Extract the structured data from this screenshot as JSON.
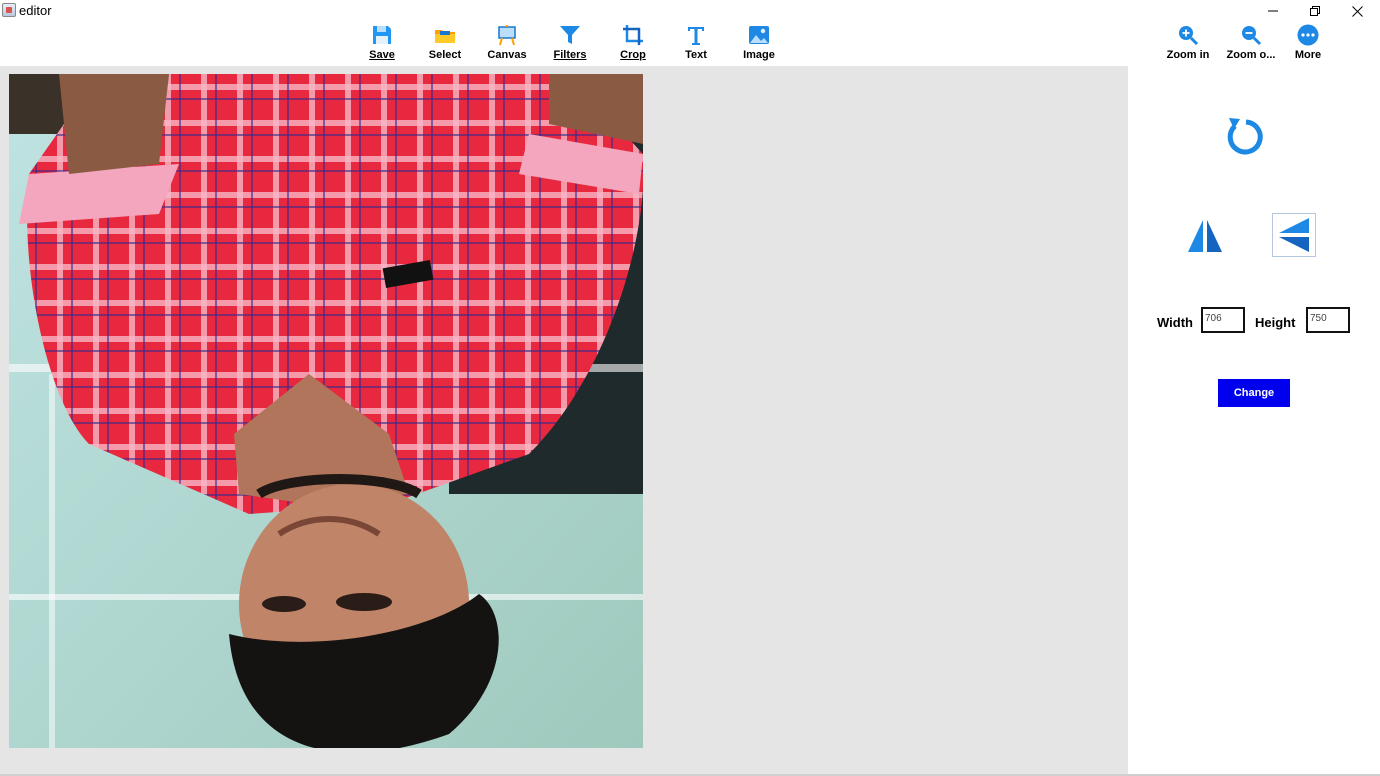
{
  "window": {
    "title": "editor"
  },
  "toolbar": {
    "save": "Save",
    "select": "Select",
    "canvas": "Canvas",
    "filters": "Filters",
    "crop": "Crop",
    "text": "Text",
    "image": "Image",
    "zoom_in": "Zoom in",
    "zoom_out": "Zoom o...",
    "more": "More"
  },
  "resize": {
    "width_label": "Width",
    "width_value": "706",
    "height_label": "Height",
    "height_value": "750",
    "change_label": "Change"
  },
  "colors": {
    "accent": "#1e88e5",
    "button": "#0000ee",
    "canvas_bg": "#e5e5e5"
  },
  "icons": [
    "save-icon",
    "select-icon",
    "canvas-icon",
    "filters-icon",
    "crop-icon",
    "text-icon",
    "image-icon",
    "zoom-in-icon",
    "zoom-out-icon",
    "more-icon",
    "rotate-icon",
    "flip-horizontal-icon",
    "flip-vertical-icon"
  ]
}
